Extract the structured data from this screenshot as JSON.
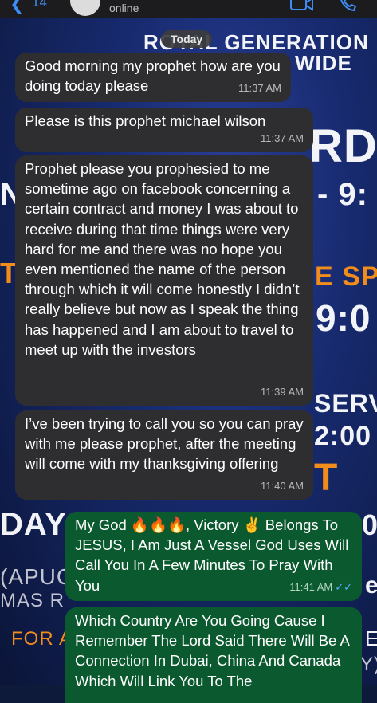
{
  "header": {
    "back_label": "14",
    "status": "online"
  },
  "background_poster": {
    "lines": [
      "ROYAL GENERATION",
      "WIDE",
      "RD",
      "N",
      "- 9:",
      "T",
      "E SPI",
      "9:0",
      "SERV",
      "2:00",
      "T",
      "DAY",
      "0",
      "(APUC",
      "MAS R",
      "e",
      "FOR A",
      "E",
      "Y)"
    ]
  },
  "date_separator": "Today",
  "messages": [
    {
      "direction": "incoming",
      "text": "Good morning my prophet how are you doing today please",
      "time": "11:37 AM"
    },
    {
      "direction": "incoming",
      "text": "Please is this prophet michael wilson",
      "time": "11:37 AM"
    },
    {
      "direction": "incoming",
      "text": "Prophet please you prophesied to me sometime ago on facebook concerning a certain contract and money I was about to receive during that time things were very hard for me and there was no hope you even mentioned the name of the person through which it will come honestly I didn’t really believe but now as I speak the thing has happened and I am about to travel to meet up with the investors",
      "time": "11:39 AM"
    },
    {
      "direction": "incoming",
      "text": "I’ve been trying to call you so you can pray with me please prophet, after the meeting will come with my thanksgiving offering",
      "time": "11:40 AM"
    },
    {
      "direction": "outgoing",
      "text": "My God 🔥🔥🔥, Victory ✌️ Belongs To JESUS, I Am Just A Vessel God Uses Will Call You In A Few Minutes To Pray With You",
      "time": "11:41 AM",
      "status": "read"
    },
    {
      "direction": "outgoing",
      "text": "Which Country Are You Going Cause I Remember The Lord Said There Will Be A Connection In Dubai, China And Canada Which Will Link You To The",
      "time": ""
    }
  ],
  "colors": {
    "incoming_bubble": "#2e2e30",
    "outgoing_bubble": "#0b5a2f",
    "accent": "#3d8cf5",
    "poster_bg": "#1a2d78"
  },
  "icons": [
    "back-chevron-icon",
    "video-call-icon",
    "voice-call-icon",
    "double-check-icon"
  ]
}
